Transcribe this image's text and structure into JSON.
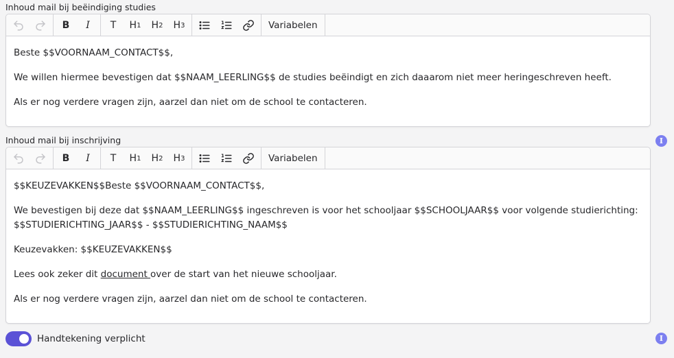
{
  "fields": [
    {
      "label": "Inhoud mail bij beëindiging studies",
      "toolbar": {
        "variables_label": "Variabelen"
      },
      "paragraphs": [
        "Beste $$VOORNAAM_CONTACT$$,",
        "We willen hiermee bevestigen dat $$NAAM_LEERLING$$ de studies beëindigt en zich daaarom niet meer heringeschreven heeft.",
        "Als er nog verdere vragen zijn, aarzel dan niet om de school te contacteren."
      ]
    },
    {
      "label": "Inhoud mail bij inschrijving",
      "toolbar": {
        "variables_label": "Variabelen"
      },
      "paragraphs": [
        "$$KEUZEVAKKEN$$Beste $$VOORNAAM_CONTACT$$,",
        "We bevestigen bij deze dat $$NAAM_LEERLING$$ ingeschreven is voor het schooljaar $$SCHOOLJAAR$$ voor volgende studierichting: $$STUDIERICHTING_JAAR$$ - $$STUDIERICHTING_NAAM$$",
        "Keuzevakken: $$KEUZEVAKKEN$$"
      ],
      "link_paragraph": {
        "before": "Lees ook zeker dit ",
        "link": "document ",
        "after": "over de start van het nieuwe schooljaar."
      },
      "closing": "Als er nog verdere vragen zijn, aarzel dan niet om de school te contacteren."
    }
  ],
  "toolbar_buttons": {
    "bold": "B",
    "italic": "I",
    "text": "T",
    "h1": "H",
    "h1_sub": "1",
    "h2": "H",
    "h2_sub": "2",
    "h3": "H",
    "h3_sub": "3"
  },
  "info_icon_glyph": "I",
  "signature_toggle": {
    "label": "Handtekening verplicht",
    "on": true
  },
  "colors": {
    "accent": "#5b52d6",
    "info": "#7c7ff0"
  }
}
